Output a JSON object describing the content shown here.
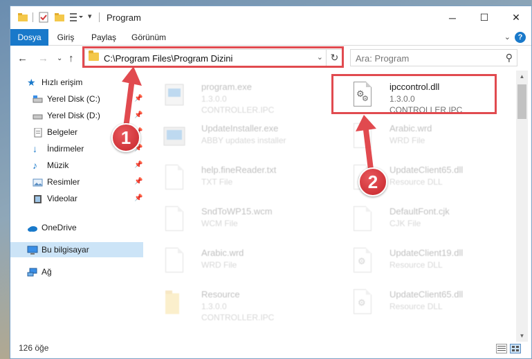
{
  "window": {
    "title": "Program"
  },
  "ribbon": {
    "tabs": [
      "Dosya",
      "Giriş",
      "Paylaş",
      "Görünüm"
    ],
    "active_tab": "Dosya"
  },
  "nav": {
    "address": "C:\\Program Files\\Program Dizini",
    "search_placeholder": "Ara: Program"
  },
  "sidebar": {
    "items": [
      {
        "label": "Hızlı erişim",
        "icon": "star-icon"
      },
      {
        "label": "Yerel Disk (C:)",
        "icon": "drive-icon"
      },
      {
        "label": "Yerel Disk (D:)",
        "icon": "drive-icon"
      },
      {
        "label": "Belgeler",
        "icon": "documents-icon"
      },
      {
        "label": "İndirmeler",
        "icon": "download-icon"
      },
      {
        "label": "Müzik",
        "icon": "music-icon"
      },
      {
        "label": "Resimler",
        "icon": "pictures-icon"
      },
      {
        "label": "Videolar",
        "icon": "video-icon"
      },
      {
        "label": "OneDrive",
        "icon": "cloud-icon"
      },
      {
        "label": "Bu bilgisayar",
        "icon": "computer-icon"
      },
      {
        "label": "Ağ",
        "icon": "network-icon"
      }
    ],
    "selected": "Bu bilgisayar"
  },
  "files": [
    {
      "name": "program.exe",
      "line1": "1.3.0.0",
      "line2": "CONTROLLER.IPC",
      "faded": true
    },
    {
      "name": "ipccontrol.dll",
      "line1": "1.3.0.0",
      "line2": "CONTROLLER.IPC",
      "faded": false
    },
    {
      "name": "UpdateInstaller.exe",
      "line1": "ABBY updates installer",
      "line2": "",
      "faded": true
    },
    {
      "name": "Arabic.wrd",
      "line1": "WRD File",
      "line2": "",
      "faded": true
    },
    {
      "name": "help.fineReader.txt",
      "line1": "TXT File",
      "line2": "",
      "faded": true
    },
    {
      "name": "UpdateClient65.dll",
      "line1": "Resource DLL",
      "line2": "",
      "faded": true
    },
    {
      "name": "SndToWP15.wcm",
      "line1": "WCM File",
      "line2": "",
      "faded": true
    },
    {
      "name": "DefaultFont.cjk",
      "line1": "CJK File",
      "line2": "",
      "faded": true
    },
    {
      "name": "Arabic.wrd",
      "line1": "WRD File",
      "line2": "",
      "faded": true
    },
    {
      "name": "UpdateClient19.dll",
      "line1": "Resource DLL",
      "line2": "",
      "faded": true
    },
    {
      "name": "Resource",
      "line1": "1.3.0.0",
      "line2": "CONTROLLER.IPC",
      "faded": true
    },
    {
      "name": "UpdateClient65.dll",
      "line1": "Resource DLL",
      "line2": "",
      "faded": true
    }
  ],
  "status": {
    "item_count": "126 öğe"
  },
  "annotations": {
    "marker1": "1",
    "marker2": "2",
    "color": "#e14a4f"
  }
}
